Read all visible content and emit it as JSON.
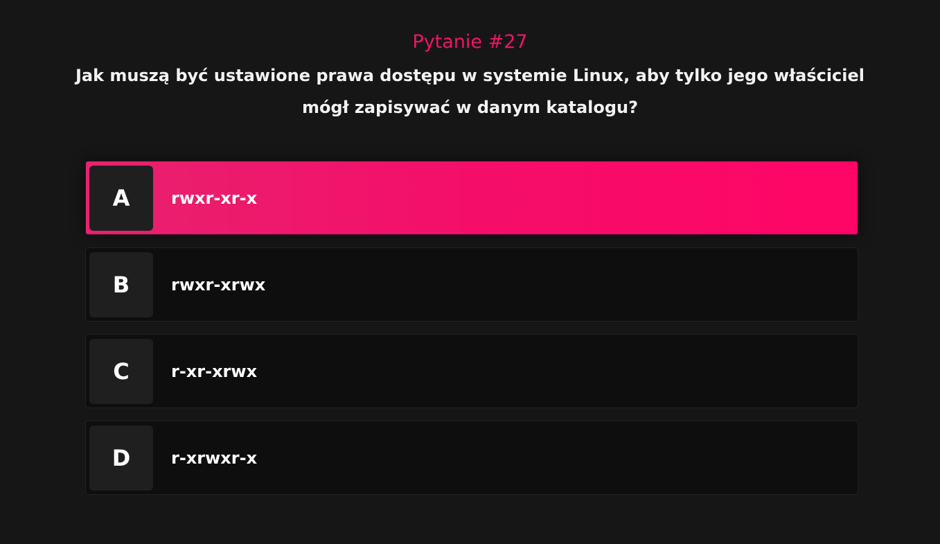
{
  "question": {
    "number_label": "Pytanie #27",
    "text": "Jak muszą być ustawione prawa dostępu w systemie Linux, aby tylko jego właściciel mógł zapisywać w danym katalogu?"
  },
  "answers": [
    {
      "letter": "A",
      "text": "rwxr-xr-x",
      "selected": true
    },
    {
      "letter": "B",
      "text": "rwxr-xrwx",
      "selected": false
    },
    {
      "letter": "C",
      "text": "r-xr-xrwx",
      "selected": false
    },
    {
      "letter": "D",
      "text": "r-xrwxr-x",
      "selected": false
    }
  ],
  "colors": {
    "background": "#161616",
    "accent": "#f01466",
    "selected_gradient_start": "#e8226e",
    "selected_gradient_end": "#ff0566",
    "option_background": "#0e0e0f",
    "letter_box": "#1f1f20"
  }
}
